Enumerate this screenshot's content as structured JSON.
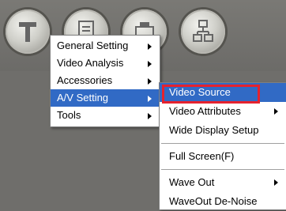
{
  "toolbar": {
    "buttons": [
      {
        "icon": "tools-icon"
      },
      {
        "icon": "document-icon"
      },
      {
        "icon": "printer-icon"
      },
      {
        "icon": "network-icon"
      }
    ]
  },
  "main_menu": {
    "items": [
      {
        "label": "General Setting",
        "has_submenu": true
      },
      {
        "label": "Video Analysis",
        "has_submenu": true
      },
      {
        "label": "Accessories",
        "has_submenu": true
      },
      {
        "label": "A/V Setting",
        "has_submenu": true,
        "selected": true
      },
      {
        "label": "Tools",
        "has_submenu": true
      }
    ]
  },
  "sub_menu": {
    "items": [
      {
        "label": "Video Source",
        "selected": true
      },
      {
        "label": "Video Attributes",
        "has_submenu": true
      },
      {
        "label": "Wide Display Setup"
      },
      {
        "label": "Full Screen(F)"
      },
      {
        "label": "Wave Out",
        "has_submenu": true
      },
      {
        "label": "WaveOut De-Noise"
      }
    ]
  },
  "colors": {
    "selection": "#316ac5",
    "highlight_border": "#e5222e",
    "background": "#6f6e6b"
  }
}
